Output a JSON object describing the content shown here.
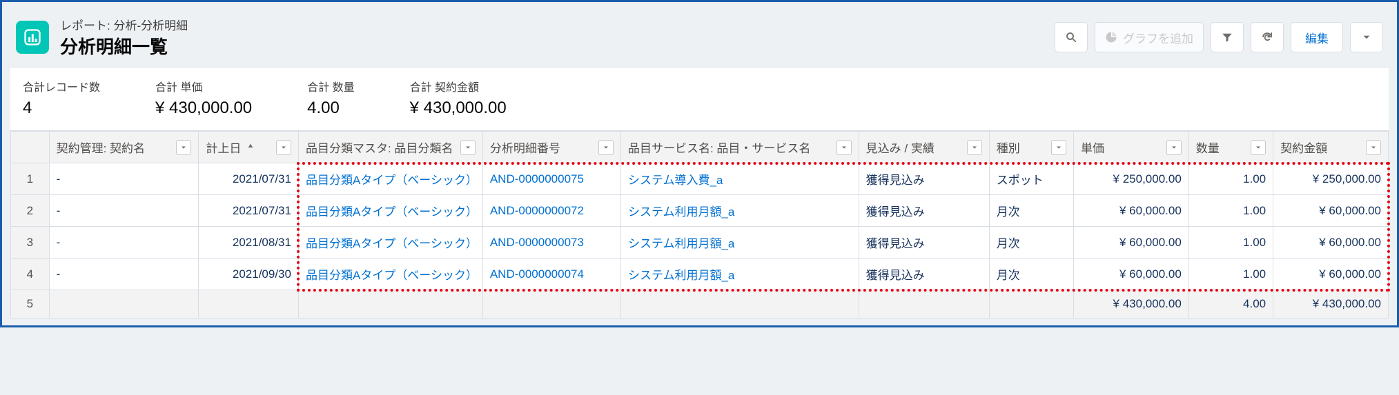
{
  "header": {
    "breadcrumb": "レポート: 分析-分析明細",
    "title": "分析明細一覧",
    "add_chart_label": "グラフを追加",
    "edit_label": "編集"
  },
  "summary": [
    {
      "label": "合計レコード数",
      "value": "4"
    },
    {
      "label": "合計 単価",
      "value": "¥ 430,000.00"
    },
    {
      "label": "合計 数量",
      "value": "4.00"
    },
    {
      "label": "合計 契約金額",
      "value": "¥ 430,000.00"
    }
  ],
  "columns": [
    "",
    "契約管理: 契約名",
    "計上日",
    "品目分類マスタ: 品目分類名",
    "分析明細番号",
    "品目サービス名: 品目・サービス名",
    "見込み / 実績",
    "種別",
    "単価",
    "数量",
    "契約金額"
  ],
  "rows": [
    {
      "num": "1",
      "contract": "-",
      "date": "2021/07/31",
      "cat": "品目分類Aタイプ（ベーシック）",
      "detail": "AND-0000000075",
      "service": "システム導入費_a",
      "status": "獲得見込み",
      "type": "スポット",
      "unit": "¥ 250,000.00",
      "qty": "1.00",
      "amount": "¥ 250,000.00"
    },
    {
      "num": "2",
      "contract": "-",
      "date": "2021/07/31",
      "cat": "品目分類Aタイプ（ベーシック）",
      "detail": "AND-0000000072",
      "service": "システム利用月額_a",
      "status": "獲得見込み",
      "type": "月次",
      "unit": "¥ 60,000.00",
      "qty": "1.00",
      "amount": "¥ 60,000.00"
    },
    {
      "num": "3",
      "contract": "-",
      "date": "2021/08/31",
      "cat": "品目分類Aタイプ（ベーシック）",
      "detail": "AND-0000000073",
      "service": "システム利用月額_a",
      "status": "獲得見込み",
      "type": "月次",
      "unit": "¥ 60,000.00",
      "qty": "1.00",
      "amount": "¥ 60,000.00"
    },
    {
      "num": "4",
      "contract": "-",
      "date": "2021/09/30",
      "cat": "品目分類Aタイプ（ベーシック）",
      "detail": "AND-0000000074",
      "service": "システム利用月額_a",
      "status": "獲得見込み",
      "type": "月次",
      "unit": "¥ 60,000.00",
      "qty": "1.00",
      "amount": "¥ 60,000.00"
    }
  ],
  "totals": {
    "num": "5",
    "unit": "¥ 430,000.00",
    "qty": "4.00",
    "amount": "¥ 430,000.00"
  }
}
